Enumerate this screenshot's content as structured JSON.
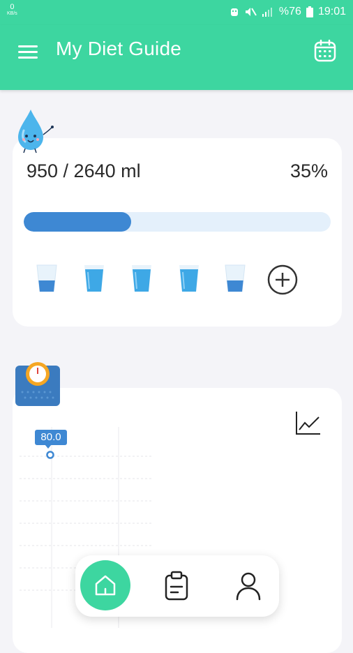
{
  "status_bar": {
    "net_speed": "0",
    "net_unit": "KB/s",
    "battery": "%76",
    "time": "19:01"
  },
  "app_bar": {
    "title": "My Diet Guide"
  },
  "water": {
    "amount": "950 / 2640 ml",
    "percent_label": "35%",
    "progress_fraction": 0.35,
    "glasses": [
      {
        "state": "partial"
      },
      {
        "state": "full"
      },
      {
        "state": "full"
      },
      {
        "state": "full"
      },
      {
        "state": "partial"
      }
    ]
  },
  "weight": {
    "value_label": "80.0"
  },
  "colors": {
    "brand": "#3dd6a0",
    "accent_blue": "#3e88d3",
    "track": "#e4f0fb"
  },
  "icons": {
    "menu": "menu-icon",
    "calendar": "calendar-icon",
    "add": "add-circle-icon",
    "chart": "line-chart-icon",
    "home": "home-icon",
    "tasks": "clipboard-icon",
    "profile": "person-icon"
  }
}
